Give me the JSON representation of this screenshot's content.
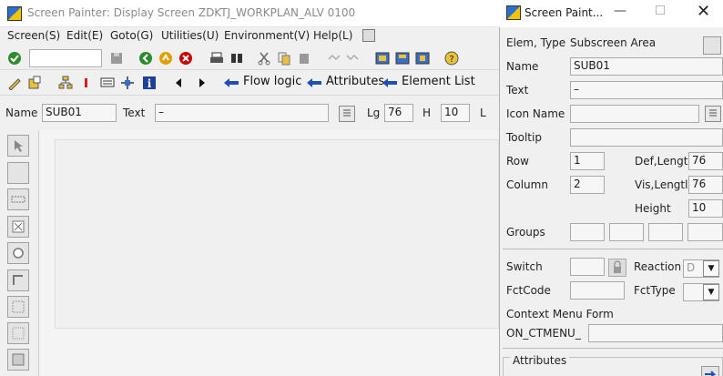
{
  "main_window": {
    "title": "Screen Painter:  Display Screen ZDKTJ_WORKPLAN_ALV 0100",
    "menus": [
      "Screen(S)",
      "Edit(E)",
      "Goto(G)",
      "Utilities(U)",
      "Environment(V)",
      "Help(L)"
    ],
    "toolbar2": {
      "flow_logic": "Flow logic",
      "attributes": "Attributes",
      "element_list": "Element List"
    },
    "fieldbar": {
      "name_label": "Name",
      "name_value": "SUB01",
      "text_label": "Text",
      "text_value": "–",
      "lg_label": "Lg",
      "lg_value": "76",
      "h_label": "H",
      "h_value": "10",
      "l_label": "L"
    }
  },
  "panel": {
    "title": "Screen Paint...",
    "elem_type_label": "Elem, Type",
    "elem_type_value": "Subscreen Area",
    "name_label": "Name",
    "name_value": "SUB01",
    "text_label": "Text",
    "text_value": "–",
    "icon_name_label": "Icon Name",
    "icon_name_value": "",
    "tooltip_label": "Tooltip",
    "tooltip_value": "",
    "row_label": "Row",
    "row_value": "1",
    "column_label": "Column",
    "column_value": "2",
    "deflength_label": "Def,Lengtl",
    "deflength_value": "76",
    "vislength_label": "Vis,Lengtl",
    "vislength_value": "76",
    "height_label": "Height",
    "height_value": "10",
    "groups_label": "Groups",
    "switch_label": "Switch",
    "switch_value": "",
    "reaction_label": "Reaction",
    "reaction_value": "D",
    "fctcode_label": "FctCode",
    "fctcode_value": "",
    "fcttype_label": "FctType",
    "fcttype_value": "",
    "context_menu_label": "Context Menu Form",
    "context_menu_prefix": "ON_CTMENU_",
    "context_menu_value": "",
    "attributes_label": "Attributes"
  }
}
